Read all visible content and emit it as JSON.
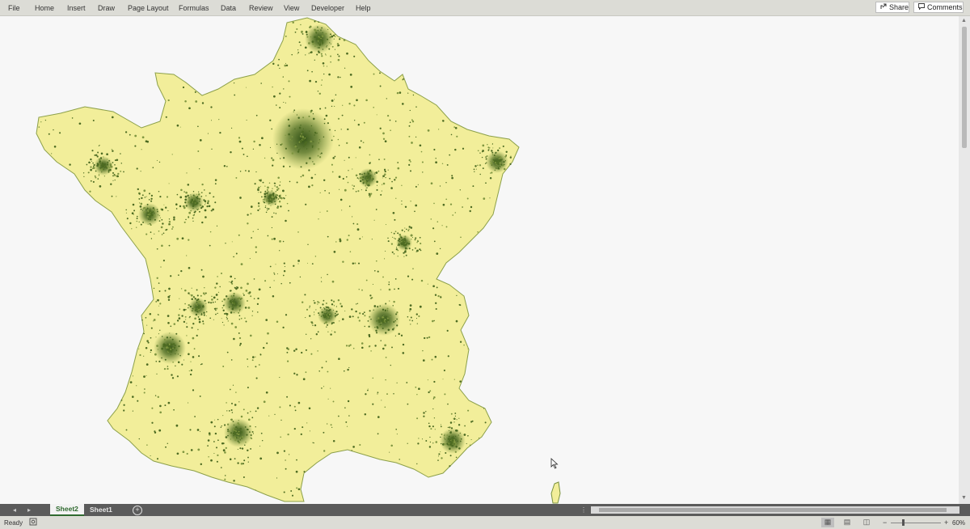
{
  "ribbon": {
    "menus": [
      {
        "key": "file",
        "label": "File"
      },
      {
        "key": "home",
        "label": "Home"
      },
      {
        "key": "insert",
        "label": "Insert"
      },
      {
        "key": "draw",
        "label": "Draw"
      },
      {
        "key": "page-layout",
        "label": "Page Layout"
      },
      {
        "key": "formulas",
        "label": "Formulas"
      },
      {
        "key": "data",
        "label": "Data"
      },
      {
        "key": "review",
        "label": "Review"
      },
      {
        "key": "view",
        "label": "View"
      },
      {
        "key": "developer",
        "label": "Developer"
      },
      {
        "key": "help",
        "label": "Help"
      }
    ],
    "share_label": "Share",
    "comments_label": "Comments",
    "share_icon": "share-icon",
    "comments_icon": "comment-icon"
  },
  "map": {
    "subject": "France population dot density map",
    "land_color": "#f2ee9a",
    "dense_color": "#3b5a1d",
    "urban_color": "#52731f",
    "background": "#f7f7f7"
  },
  "sheets": {
    "tabs": [
      {
        "label": "Sheet2",
        "active": true
      },
      {
        "label": "Sheet1",
        "active": false
      }
    ],
    "add_icon": "plus-circle-icon"
  },
  "status": {
    "text": "Ready",
    "zoom_level": "60%",
    "zoom_fraction": 0.3,
    "accessibility_icon": "accessibility-icon"
  }
}
